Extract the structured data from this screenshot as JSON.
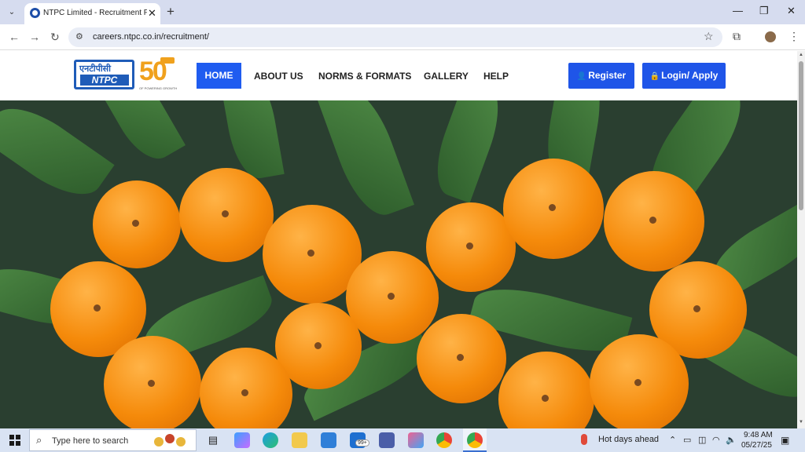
{
  "browser": {
    "tab_title": "NTPC Limited - Recruitment Po",
    "url": "careers.ntpc.co.in/recruitment/",
    "new_tab_label": "+",
    "close_tab_label": "✕"
  },
  "site": {
    "logo_hindi": "एनटीपीसी",
    "logo_text": "NTPC",
    "anniversary_number": "50",
    "anniversary_tagline": "OF POWERING GROWTH",
    "nav": [
      "HOME",
      "ABOUT US",
      "NORMS & FORMATS",
      "GALLERY",
      "HELP"
    ],
    "register_label": "Register",
    "login_label": "Login/ Apply"
  },
  "banner": {
    "description_icon": "oranges-leaves-image"
  },
  "taskbar": {
    "search_placeholder": "Type here to search",
    "weather_text": "Hot days ahead",
    "time": "9:48 AM",
    "date": "05/27/25",
    "mail_badge": "99+"
  },
  "colors": {
    "accent": "#1f5cf0",
    "button": "#1f55e8",
    "tabbar": "#d6dcef",
    "taskbar": "#d9e3f3"
  }
}
